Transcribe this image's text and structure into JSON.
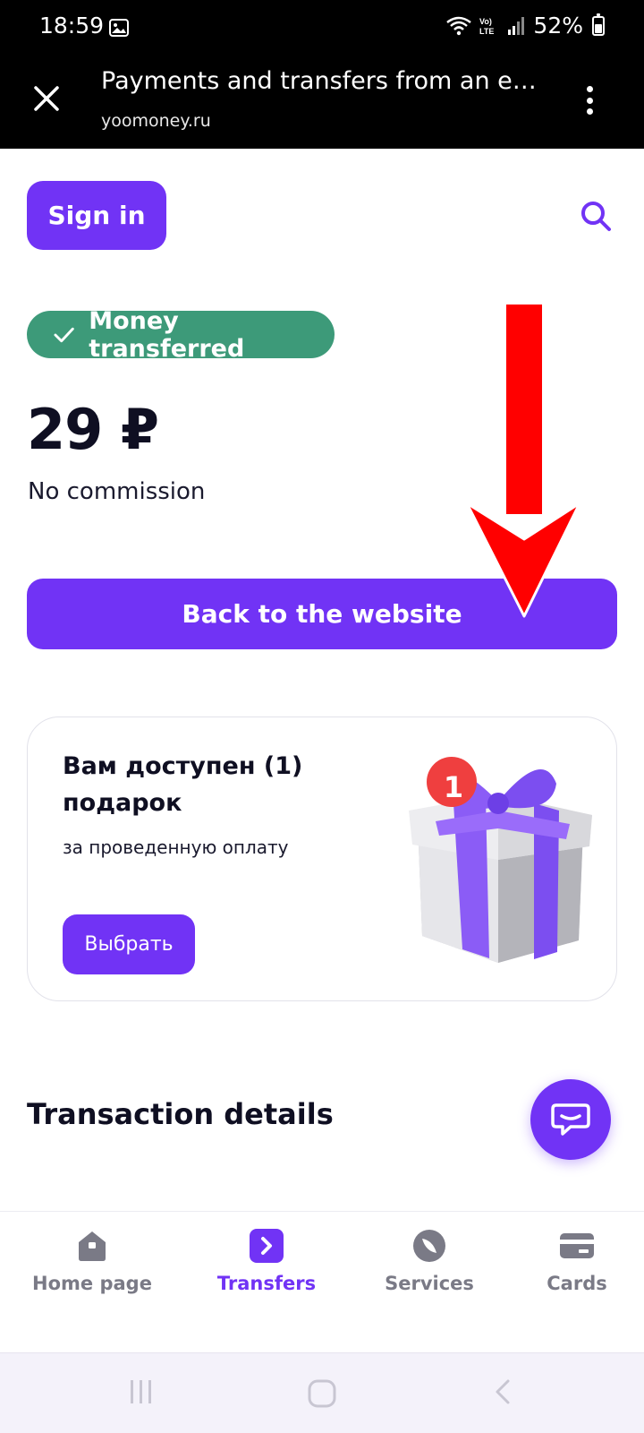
{
  "status_bar": {
    "time": "18:59",
    "battery": "52%",
    "battery_level": 0.52,
    "network_label": "Vo) LTE"
  },
  "browser": {
    "title": "Payments and transfers from an electr...",
    "url": "yoomoney.ru"
  },
  "header": {
    "sign_in_label": "Sign in"
  },
  "payment": {
    "status_label": "Money transferred",
    "amount": "29 ₽",
    "commission": "No commission",
    "back_button_label": "Back to the website",
    "status_color": "#3d9a79"
  },
  "gift": {
    "title": "Вам доступен (1) подарок",
    "subtitle": "за проведенную оплату",
    "button_label": "Выбрать",
    "badge_count": "1"
  },
  "details": {
    "title": "Transaction details"
  },
  "nav": {
    "items": [
      {
        "label": "Home page",
        "icon": "home-icon",
        "active": false
      },
      {
        "label": "Transfers",
        "icon": "transfers-icon",
        "active": true
      },
      {
        "label": "Services",
        "icon": "services-icon",
        "active": false
      },
      {
        "label": "Cards",
        "icon": "card-icon",
        "active": false
      }
    ]
  },
  "colors": {
    "accent": "#7133f5",
    "annotation_arrow": "#ff0000"
  }
}
